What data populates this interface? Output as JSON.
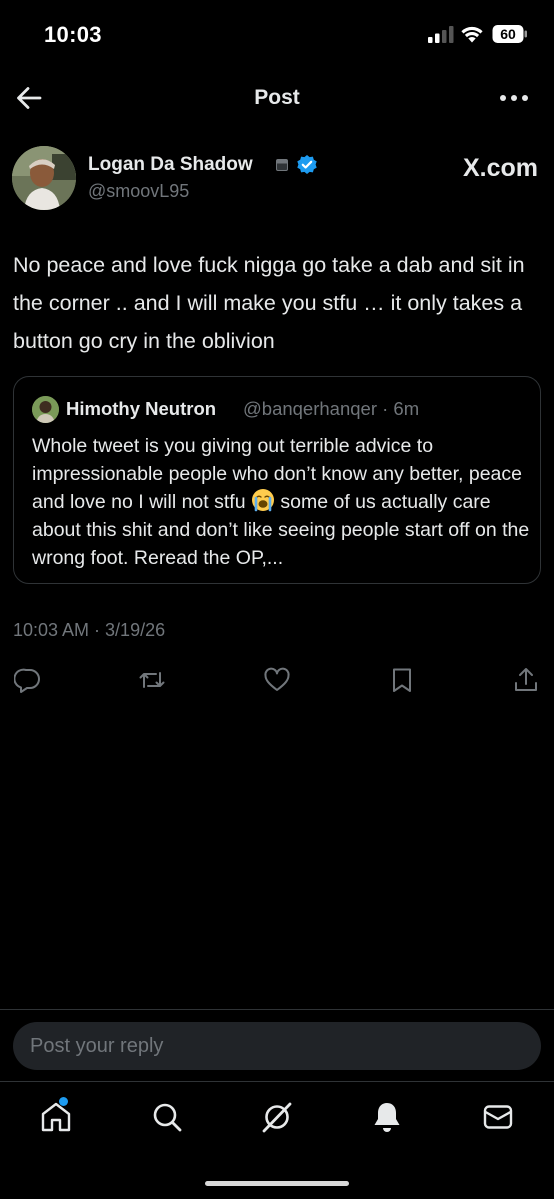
{
  "status_bar": {
    "time": "10:03",
    "battery_level": "60"
  },
  "header": {
    "title": "Post"
  },
  "author": {
    "name": "Logan Da Shadow",
    "handle": "@smoovL95",
    "verified": true,
    "source_logo": "X.com"
  },
  "tweet": {
    "text": "No peace and love fuck nigga go take a dab and sit in the corner .. and I will make you stfu … it only takes a button go cry in the oblivion",
    "timestamp": "10:03 AM · 3/19/26"
  },
  "quote": {
    "name": "Himothy Neutron",
    "handle_time": "@banqerhanqer · 6m",
    "text_before_emoji": "Whole tweet is you giving out terrible advice to impressionable people who don’t know any better, peace and love no I will not stfu ",
    "emoji": "crying-face-emoji",
    "text_after_emoji": " some of us actually care about this shit and don’t like seeing people start off on the wrong foot. Reread the OP,..."
  },
  "actions": [
    "reply-icon",
    "repost-icon",
    "like-icon",
    "bookmark-icon",
    "share-icon"
  ],
  "reply": {
    "placeholder": "Post your reply"
  },
  "bottom_nav": [
    "home-icon",
    "search-icon",
    "grok-icon",
    "notifications-icon",
    "messages-icon"
  ],
  "colors": {
    "background": "#000000",
    "primary_text": "#e7e9ea",
    "secondary_text": "#71767b",
    "border": "#2f3336",
    "accent": "#1d9bf0"
  }
}
